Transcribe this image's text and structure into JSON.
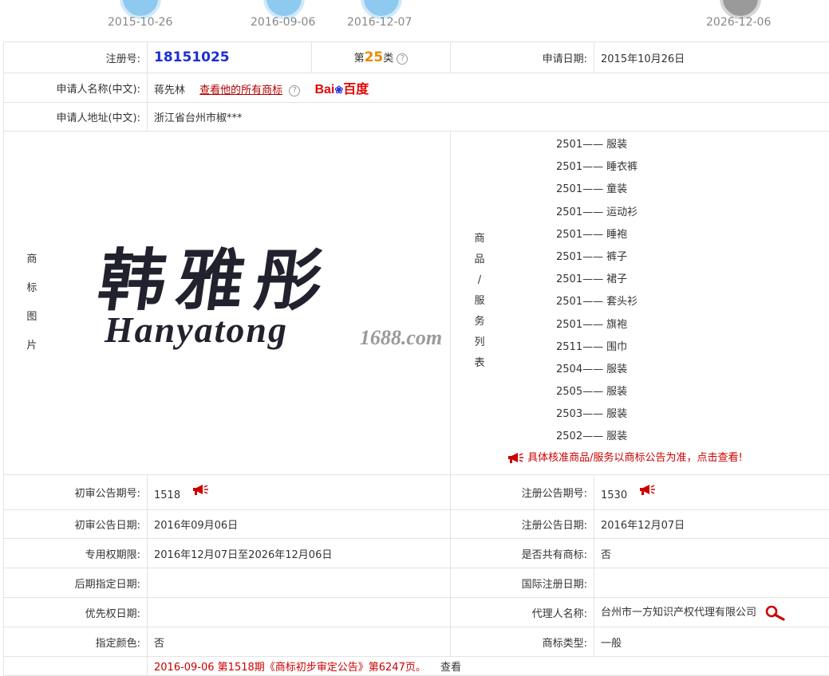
{
  "timeline": {
    "dates": [
      "2015-10-26",
      "2016-09-06",
      "2016-12-07",
      "2026-12-06"
    ]
  },
  "info": {
    "reg_no_label": "注册号:",
    "reg_no": "18151025",
    "class_prefix": "第",
    "class_num": "25",
    "class_suffix": "类",
    "apply_date_label": "申请日期:",
    "apply_date": "2015年10月26日",
    "applicant_label": "申请人名称(中文):",
    "applicant": "蒋先林",
    "view_all_link": "查看他的所有商标",
    "baidu_bai": "Bai",
    "baidu_du": "百度",
    "address_label": "申请人地址(中文):",
    "address": "浙江省台州市椒***",
    "image_label": [
      "商",
      "标",
      "图",
      "片"
    ],
    "trademark_cn": "韩雅彤",
    "trademark_en": "Hanyatong",
    "watermark": "1688.com",
    "goods_label": [
      "商",
      "品",
      "/",
      "服",
      "务",
      "列",
      "表"
    ],
    "goods": [
      {
        "code": "2501",
        "name": "服装"
      },
      {
        "code": "2501",
        "name": "睡衣裤"
      },
      {
        "code": "2501",
        "name": "童装"
      },
      {
        "code": "2501",
        "name": "运动衫"
      },
      {
        "code": "2501",
        "name": "睡袍"
      },
      {
        "code": "2501",
        "name": "裤子"
      },
      {
        "code": "2501",
        "name": "裙子"
      },
      {
        "code": "2501",
        "name": "套头衫"
      },
      {
        "code": "2501",
        "name": "旗袍"
      },
      {
        "code": "2511",
        "name": "围巾"
      },
      {
        "code": "2504",
        "name": "服装"
      },
      {
        "code": "2505",
        "name": "服装"
      },
      {
        "code": "2503",
        "name": "服装"
      },
      {
        "code": "2502",
        "name": "服装"
      }
    ],
    "goods_dash": "——",
    "goods_notice": "具体核准商品/服务以商标公告为准，点击查看!",
    "prelim_no_label": "初审公告期号:",
    "prelim_no": "1518",
    "reg_pub_no_label": "注册公告期号:",
    "reg_pub_no": "1530",
    "prelim_date_label": "初审公告日期:",
    "prelim_date": "2016年09月06日",
    "reg_pub_date_label": "注册公告日期:",
    "reg_pub_date": "2016年12月07日",
    "exclusive_label": "专用权期限:",
    "exclusive": "2016年12月07日至2026年12月06日",
    "shared_label": "是否共有商标:",
    "shared": "否",
    "later_label": "后期指定日期:",
    "later": "",
    "intl_label": "国际注册日期:",
    "intl": "",
    "priority_label": "优先权日期:",
    "priority": "",
    "agent_label": "代理人名称:",
    "agent": "台州市一方知识产权代理有限公司",
    "color_label": "指定颜色:",
    "color": "否",
    "type_label": "商标类型:",
    "type": "一般",
    "pub_line": "2016-09-06 第1518期《商标初步审定公告》第6247页。",
    "pub_view": "查看"
  },
  "colors": {
    "reg_no": "#1c2fd2",
    "class_num": "#e88a00",
    "notice_red": "#cc0000",
    "timeline_blue": "#8ec9ef",
    "timeline_gray": "#9a9a9a"
  }
}
